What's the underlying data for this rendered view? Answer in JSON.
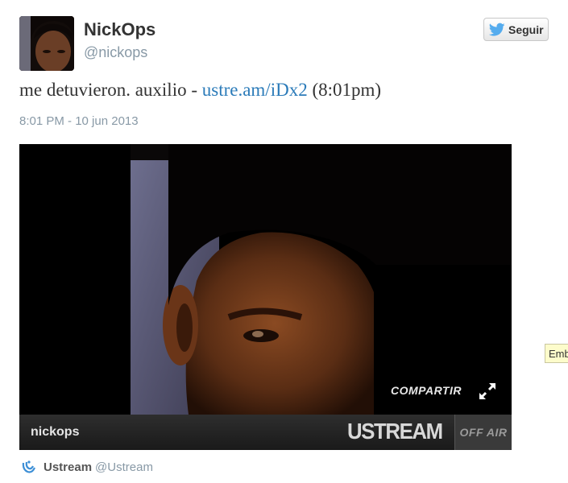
{
  "user": {
    "display_name": "NickOps",
    "handle": "@nickops",
    "avatar_icon": "profile-photo"
  },
  "follow_button": {
    "label": "Seguir",
    "icon": "twitter-bird-icon",
    "icon_color": "#55acee"
  },
  "tweet": {
    "text_before": "me detuvieron. auxilio - ",
    "link_text": "ustre.am/iDx2",
    "text_after": " (8:01pm)",
    "link_color": "#2b7bb9",
    "timestamp": "8:01 PM - 10 jun 2013"
  },
  "player": {
    "share_label": "COMPARTIR",
    "expand_icon": "expand-arrows-icon",
    "channel_name": "nickops",
    "brand_logo": "USTREAM",
    "status": "OFF AIR"
  },
  "attribution": {
    "icon": "ustream-icon",
    "name": "Ustream",
    "handle": "@Ustream"
  },
  "tooltip": {
    "text": "Embed"
  }
}
